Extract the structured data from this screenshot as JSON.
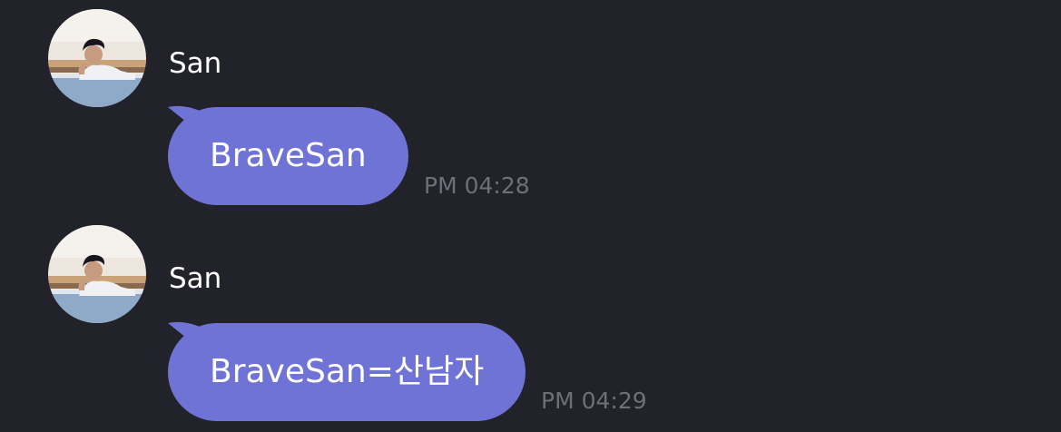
{
  "colors": {
    "background": "#22222a",
    "bubble": "#7073d6",
    "text": "#ffffff",
    "timestamp": "#6f6f78"
  },
  "messages": [
    {
      "sender": "San",
      "avatar": "profile-photo-icon",
      "text": "BraveSan",
      "time": "PM 04:28"
    },
    {
      "sender": "San",
      "avatar": "profile-photo-icon",
      "text": "BraveSan=산남자",
      "time": "PM 04:29"
    }
  ]
}
